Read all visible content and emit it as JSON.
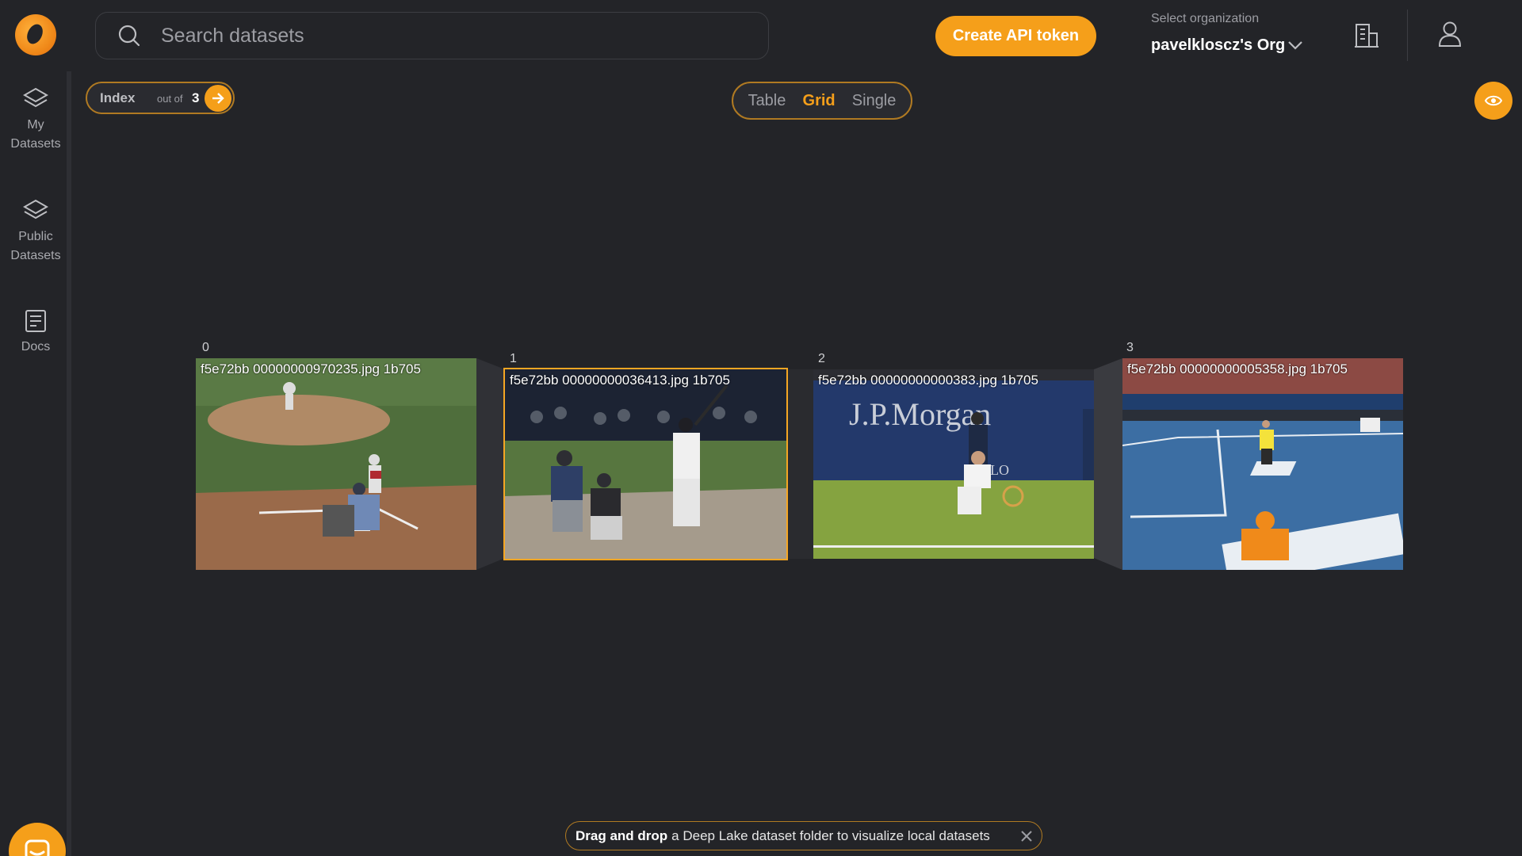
{
  "header": {
    "search_placeholder": "Search datasets",
    "api_button": "Create API token",
    "org_label": "Select organization",
    "org_name": "pavelkloscz's Org"
  },
  "sidebar": {
    "items": [
      {
        "label_line1": "My",
        "label_line2": "Datasets",
        "icon": "layers-icon"
      },
      {
        "label_line1": "Public",
        "label_line2": "Datasets",
        "icon": "layers-icon"
      },
      {
        "label_line1": "Docs",
        "label_line2": "",
        "icon": "document-icon"
      }
    ]
  },
  "index": {
    "label": "Index",
    "out_of": "out of",
    "total": "3"
  },
  "view_toggle": {
    "table": "Table",
    "grid": "Grid",
    "single": "Single",
    "active": "Grid"
  },
  "grid": {
    "items": [
      {
        "index": "0",
        "caption": "f5e72bb  00000000970235.jpg  1b705",
        "scene": "baseball-field"
      },
      {
        "index": "1",
        "caption": "f5e72bb  00000000036413.jpg  1b705",
        "scene": "baseball-batter",
        "selected": true
      },
      {
        "index": "2",
        "caption": "f5e72bb  00000000000383.jpg  1b705",
        "scene": "tennis-jpmorgan"
      },
      {
        "index": "3",
        "caption": "f5e72bb  00000000005358.jpg  1b705",
        "scene": "tennis-court"
      }
    ]
  },
  "toast": {
    "bold": "Drag and drop",
    "text": "a Deep Lake dataset folder to visualize local datasets"
  },
  "colors": {
    "accent": "#f59f1a",
    "background": "#232428",
    "border_accent": "#b07a22"
  }
}
